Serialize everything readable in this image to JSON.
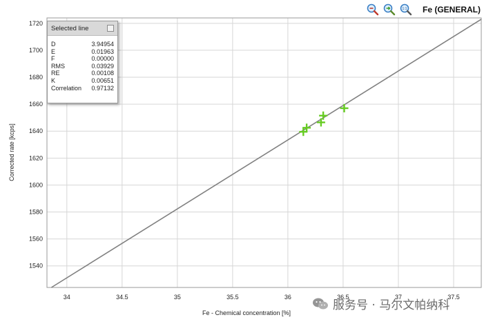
{
  "toolbar": {
    "title": "Fe (GENERAL)",
    "icons": [
      "zoom-out-icon",
      "zoom-reset-icon",
      "zoom-1to1-icon"
    ]
  },
  "stats_panel": {
    "header": "Selected line",
    "rows": [
      {
        "label": "D",
        "value": "3.94954"
      },
      {
        "label": "E",
        "value": "0.01963"
      },
      {
        "label": "F",
        "value": "0.00000"
      },
      {
        "label": "RMS",
        "value": "0.03929"
      },
      {
        "label": "RE",
        "value": "0.00108"
      },
      {
        "label": "K",
        "value": "0.00651"
      },
      {
        "label": "Correlation",
        "value": "0.97132"
      }
    ]
  },
  "watermark": {
    "text": "服务号 · 马尔文帕纳科"
  },
  "colors": {
    "line": "#808080",
    "points": "#66cc22",
    "grid": "#d6d6d6"
  },
  "chart_data": {
    "type": "scatter",
    "title": "Fe (GENERAL)",
    "xlabel": "Fe - Chemical concentration [%]",
    "ylabel": "Corrected rate [kcps]",
    "xlim": [
      33.82,
      37.75
    ],
    "ylim": [
      1524,
      1724
    ],
    "xticks": [
      "34",
      "34.5",
      "35",
      "35.5",
      "36",
      "36.5",
      "37",
      "37.5"
    ],
    "xtick_values": [
      34,
      34.5,
      35,
      35.5,
      36,
      36.5,
      37,
      37.5
    ],
    "yticks": [
      "1540",
      "1560",
      "1580",
      "1600",
      "1620",
      "1640",
      "1660",
      "1680",
      "1700",
      "1720"
    ],
    "ytick_values": [
      1540,
      1560,
      1580,
      1600,
      1620,
      1640,
      1660,
      1680,
      1700,
      1720
    ],
    "grid": true,
    "series": [
      {
        "type": "scatter",
        "marker": "+",
        "x": [
          36.14,
          36.17,
          36.3,
          36.32,
          36.51
        ],
        "y": [
          1639.5,
          1642.5,
          1646.5,
          1651.5,
          1657.0
        ]
      },
      {
        "type": "line",
        "x": [
          33.86,
          37.75
        ],
        "y": [
          1524,
          1723
        ]
      }
    ]
  }
}
